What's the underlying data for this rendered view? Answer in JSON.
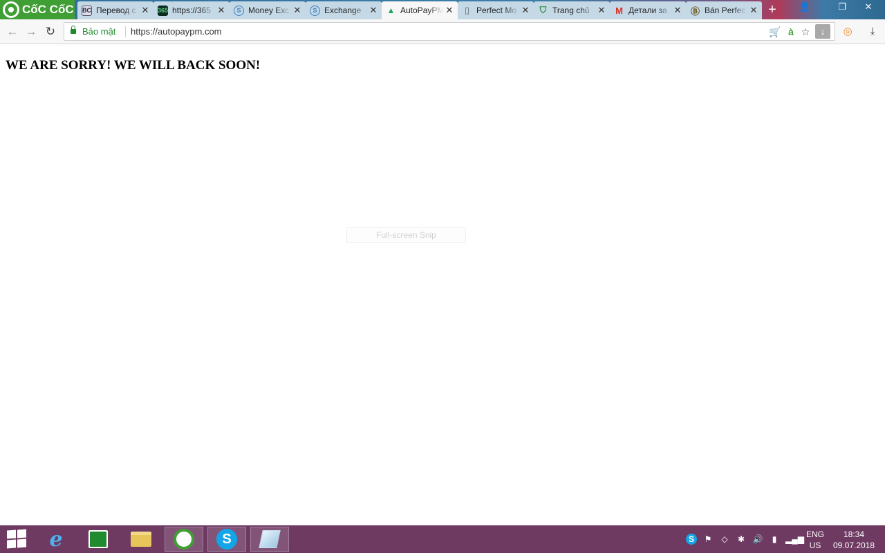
{
  "browser": {
    "brand": "CốC CốC",
    "tabs": [
      {
        "title": "Перевод с",
        "favicon": "BC",
        "favicon_icon": "bc-icon"
      },
      {
        "title": "https://365",
        "favicon": "365",
        "favicon_icon": "365-icon"
      },
      {
        "title": "Money Exc",
        "favicon": "S",
        "favicon_icon": "exchange-s-icon"
      },
      {
        "title": "Exchange",
        "favicon": "S",
        "favicon_icon": "exchange-s-icon"
      },
      {
        "title": "AutoPayPM",
        "favicon": "▲",
        "favicon_icon": "google-drive-icon"
      },
      {
        "title": "Perfect Mo",
        "favicon": "▯",
        "favicon_icon": "page-icon"
      },
      {
        "title": "Trang chủ",
        "favicon": "⛉",
        "favicon_icon": "shield-icon"
      },
      {
        "title": "Детали за",
        "favicon": "M",
        "favicon_icon": "gmail-icon"
      },
      {
        "title": "Bán Perfec",
        "favicon": "Ⓑ",
        "favicon_icon": "coin-icon"
      }
    ],
    "active_tab_index": 4,
    "secure_label": "Bảo mật",
    "url": "https://autopaypm.com"
  },
  "page": {
    "heading": "WE ARE SORRY! WE WILL BACK SOON!",
    "snip_tooltip": "Full-screen Snip"
  },
  "taskbar": {
    "apps": [
      {
        "name": "internet-explorer-icon",
        "open": false
      },
      {
        "name": "store-icon",
        "open": false
      },
      {
        "name": "file-explorer-icon",
        "open": false
      },
      {
        "name": "coccoc-browser-icon",
        "open": true
      },
      {
        "name": "skype-icon",
        "open": true
      },
      {
        "name": "snipping-tool-icon",
        "open": true
      }
    ],
    "lang_line1": "ENG",
    "lang_line2": "US",
    "time": "18:34",
    "date": "09.07.2018"
  },
  "colors": {
    "accent_green": "#3f9e34",
    "secure_green": "#1e8a2e",
    "taskbar": "#6e3a62"
  }
}
